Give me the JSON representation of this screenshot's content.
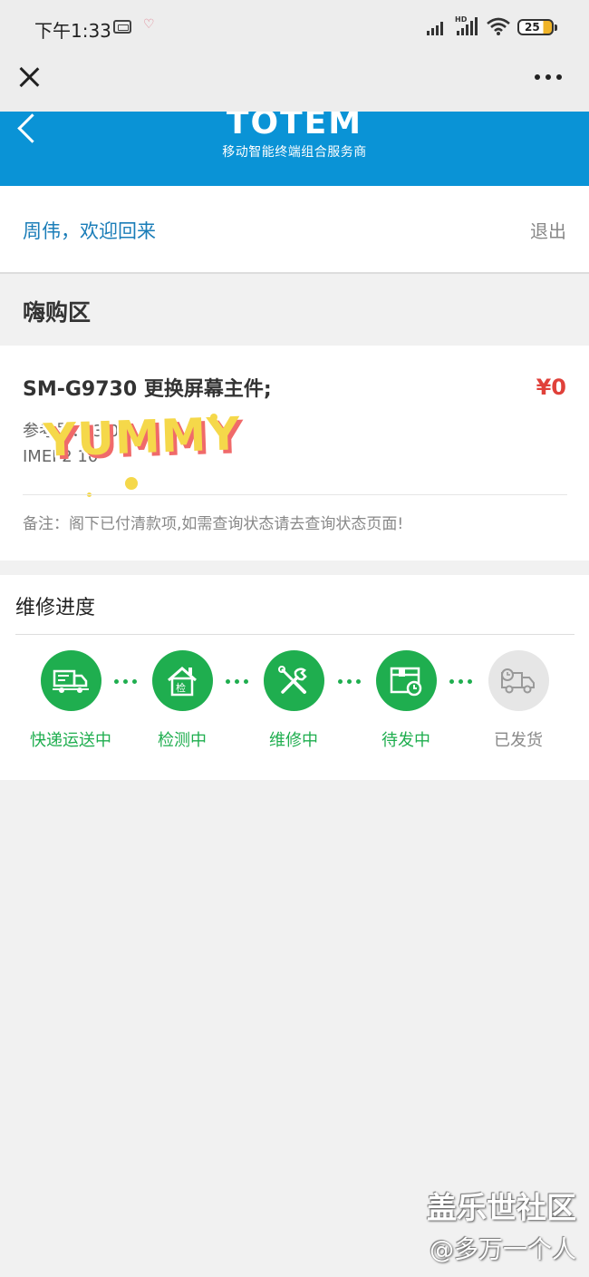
{
  "status_bar": {
    "time": "下午1:33",
    "battery": "25"
  },
  "header": {
    "brand_title": "TOTEM",
    "brand_subtitle": "移动智能终端组合服务商"
  },
  "welcome": {
    "greeting": "周伟，欢迎回来",
    "logout": "退出"
  },
  "section": {
    "title": "嗨购区"
  },
  "order": {
    "product": "SM-G9730 更换屏幕主件;",
    "price": "¥0",
    "ref_line": "参考号：  3  0",
    "imei_line": "IMEI  2        10",
    "note": "备注：阁下已付清款项,如需查询状态请去查询状态页面!",
    "sticker": "YUMMY"
  },
  "progress": {
    "title": "维修进度",
    "steps": [
      {
        "label": "快递运送中",
        "icon": "delivery-truck-icon",
        "active": true
      },
      {
        "label": "检测中",
        "icon": "inspection-house-icon",
        "active": true
      },
      {
        "label": "维修中",
        "icon": "repair-tools-icon",
        "active": true
      },
      {
        "label": "待发中",
        "icon": "pending-box-clock-icon",
        "active": true
      },
      {
        "label": "已发货",
        "icon": "shipped-truck-icon",
        "active": false
      }
    ]
  },
  "watermark": {
    "line1": "盖乐世社区",
    "line2": "@多万一个人"
  },
  "colors": {
    "brand_blue": "#0a93d6",
    "progress_green": "#1fae4f",
    "price_red": "#e0413a",
    "welcome_blue": "#1a7db8"
  }
}
